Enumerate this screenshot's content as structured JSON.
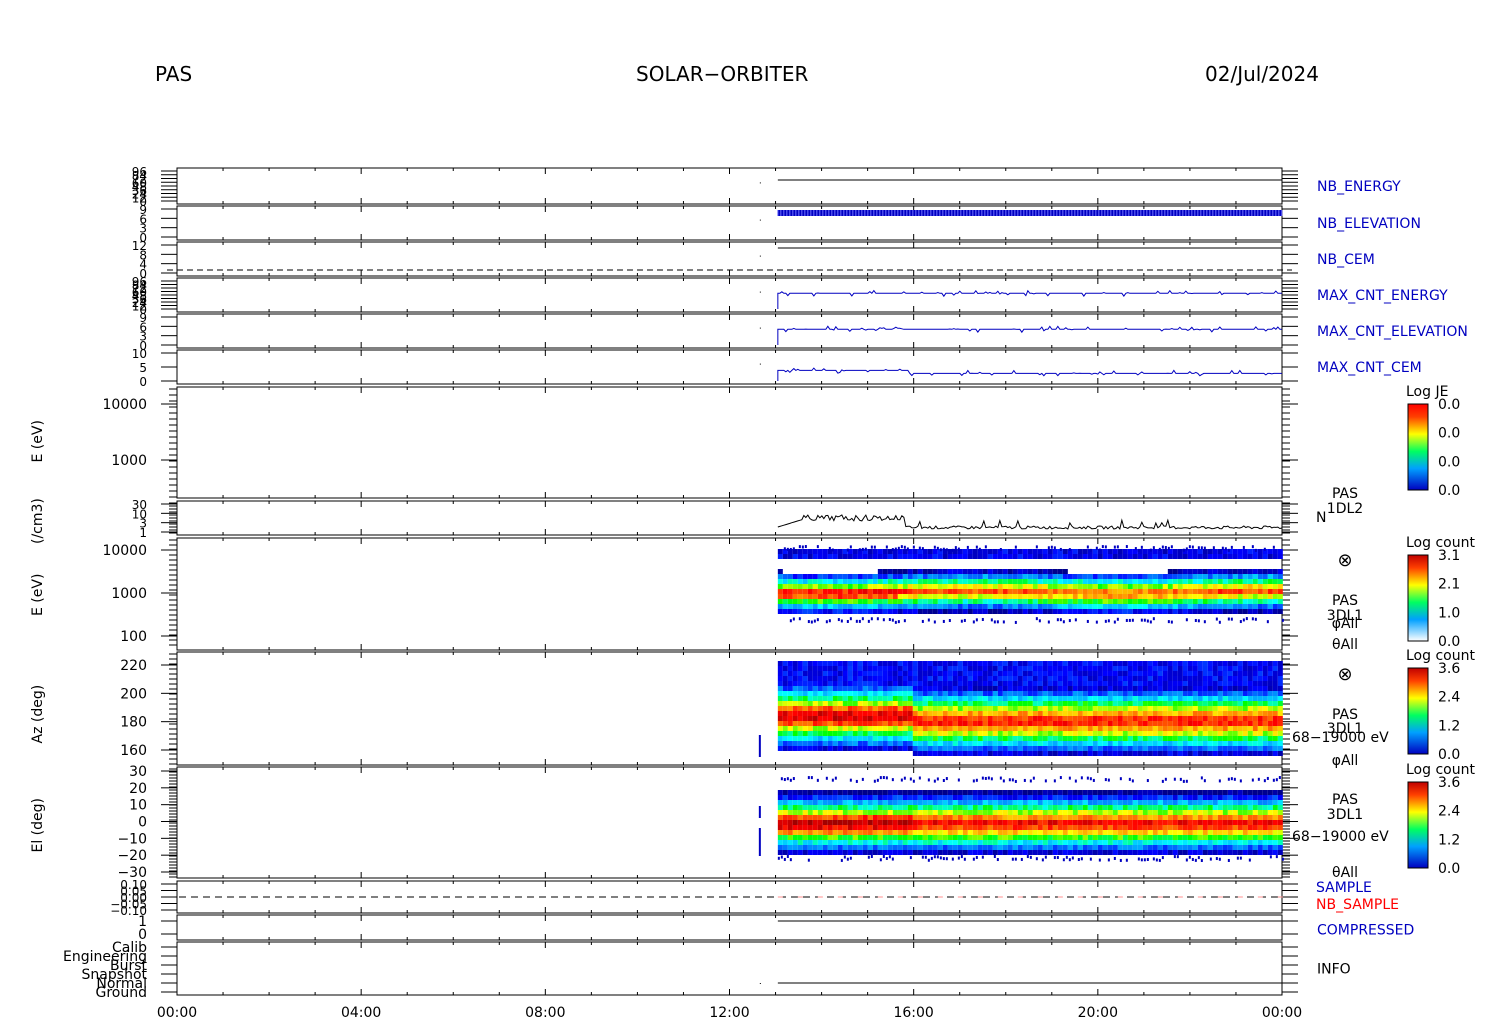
{
  "header": {
    "instrument": "PAS",
    "mission": "SOLAR−ORBITER",
    "date": "02/Jul/2024"
  },
  "chart_data": {
    "type": "multi-panel time series and spectrogram",
    "time_axis": {
      "ticks": [
        "00:00",
        "04:00",
        "08:00",
        "12:00",
        "16:00",
        "20:00",
        "00:00"
      ],
      "range_hours": [
        0,
        24
      ],
      "data_start_hour": 13.05
    },
    "panels": [
      {
        "id": "nb_energy",
        "label": "NB_ENERGY",
        "label_color": "#0000c0",
        "type": "line",
        "value_level": 0.7,
        "tick_labels": [
          "96",
          "84",
          "72",
          "60",
          "48",
          "36",
          "24",
          "12",
          "0"
        ]
      },
      {
        "id": "nb_elevation",
        "label": "NB_ELEVATION",
        "label_color": "#0000c0",
        "type": "bar-comb",
        "value_level": 0.8,
        "tick_labels": [
          "9",
          "6",
          "3",
          "0"
        ]
      },
      {
        "id": "nb_cem",
        "label": "NB_CEM",
        "label_color": "#0000c0",
        "type": "line",
        "value_level": 0.85,
        "tick_labels": [
          "12",
          "8",
          "4",
          "0"
        ]
      },
      {
        "id": "max_cnt_energy",
        "label": "MAX_CNT_ENERGY",
        "label_color": "#0000c0",
        "type": "line",
        "value_level": 0.55,
        "tick_labels": [
          "96",
          "84",
          "72",
          "60",
          "48",
          "36",
          "24",
          "12",
          "0"
        ]
      },
      {
        "id": "max_cnt_elevation",
        "label": "MAX_CNT_ELEVATION",
        "label_color": "#0000c0",
        "type": "line",
        "value_level": 0.55,
        "tick_labels": [
          "9",
          "6",
          "3",
          "0"
        ]
      },
      {
        "id": "max_cnt_cem",
        "label": "MAX_CNT_CEM",
        "label_color": "#0000c0",
        "type": "line",
        "value_level": 0.4,
        "tick_labels": [
          "10",
          "5",
          "0"
        ]
      },
      {
        "id": "energy_1d",
        "ylabel": "E (eV)",
        "type": "empty-spectrogram",
        "ytick_labels": [
          "10000",
          "1000"
        ],
        "colorbar": {
          "title": "Log JE",
          "ticks": [
            "0.0",
            "0.0",
            "0.0",
            "0.0"
          ]
        }
      },
      {
        "id": "density",
        "ylabel": "(/cm3)",
        "type": "line",
        "ytick_labels": [
          "30",
          "10",
          "3",
          "1"
        ],
        "side_labels": [
          "PAS",
          "1DL2",
          "N"
        ]
      },
      {
        "id": "energy_3d",
        "ylabel": "E (eV)",
        "type": "spectrogram",
        "ytick_labels": [
          "10000",
          "1000",
          "100"
        ],
        "side_labels": [
          "PAS",
          "3DL1",
          "φAll",
          "θAll"
        ],
        "colorbar": {
          "title": "Log count",
          "ticks": [
            "3.1",
            "2.1",
            "1.0",
            "0.0"
          ]
        }
      },
      {
        "id": "azimuth",
        "ylabel": "Az (deg)",
        "type": "spectrogram",
        "ytick_labels": [
          "220",
          "200",
          "180",
          "160"
        ],
        "side_labels": [
          "PAS",
          "3DL1",
          "68−19000 eV",
          "φAll"
        ],
        "colorbar": {
          "title": "Log count",
          "ticks": [
            "3.6",
            "2.4",
            "1.2",
            "0.0"
          ]
        }
      },
      {
        "id": "elevation",
        "ylabel": "El (deg)",
        "type": "spectrogram",
        "ytick_labels": [
          "30",
          "20",
          "10",
          "0",
          "−10",
          "−20",
          "−30"
        ],
        "side_labels": [
          "PAS",
          "3DL1",
          "68−19000 eV",
          "θAll"
        ],
        "colorbar": {
          "title": "Log count",
          "ticks": [
            "3.6",
            "2.4",
            "1.2",
            "0.0"
          ]
        }
      },
      {
        "id": "sample",
        "labels": [
          "SAMPLE",
          "NB_SAMPLE"
        ],
        "label_colors": [
          "#0000c0",
          "#ff0000"
        ],
        "type": "dashed",
        "ytick_labels": [
          "0.10",
          "0.05",
          "0.00",
          "−0.05",
          "−0.10"
        ]
      },
      {
        "id": "compressed",
        "label": "COMPRESSED",
        "label_color": "#0000c0",
        "type": "line",
        "ytick_labels": [
          "1",
          "0"
        ]
      },
      {
        "id": "info",
        "label": "INFO",
        "label_color": "#000000",
        "type": "line",
        "ytick_labels": [
          "Calib",
          "Engineering",
          "Burst",
          "Snapshot",
          "Normal",
          "Ground"
        ]
      }
    ]
  }
}
